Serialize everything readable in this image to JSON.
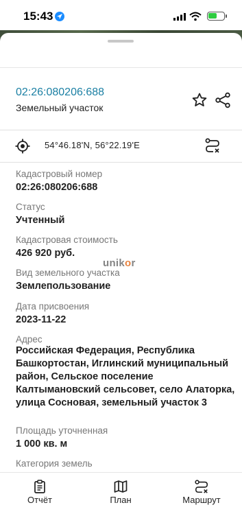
{
  "status_bar": {
    "time": "15:43"
  },
  "object": {
    "cadastral_link": "02:26:080206:688",
    "type": "Земельный участок",
    "coordinates": "54°46.18'N, 56°22.19'E"
  },
  "fields": [
    {
      "label": "Кадастровый номер",
      "value": "02:26:080206:688"
    },
    {
      "label": "Статус",
      "value": "Учтенный"
    },
    {
      "label": "Кадастровая стоимость",
      "value": "426 920 руб."
    },
    {
      "label": "Вид земельного участка",
      "value": "Землепользование"
    },
    {
      "label": "Дата присвоения",
      "value": "2023-11-22"
    },
    {
      "label": "Адрес",
      "value": "Российская Федерация, Республика Башкортостан, Иглинский муниципальный район, Сельское поселение Калтымановский сельсовет, село Алаторка, улица Сосновая, земельный участок 3"
    },
    {
      "label": "Площадь уточненная",
      "value": "1 000 кв. м"
    },
    {
      "label": "Категория земель",
      "value": ""
    }
  ],
  "watermark": {
    "prefix": "unik",
    "middle": "o",
    "suffix": "r"
  },
  "bottom_nav": [
    {
      "label": "Отчёт",
      "icon": "report-icon"
    },
    {
      "label": "План",
      "icon": "map-icon"
    },
    {
      "label": "Маршрут",
      "icon": "route-icon"
    }
  ],
  "colors": {
    "link": "#1a7fa3",
    "label": "#777777",
    "text": "#1f1f1f"
  }
}
